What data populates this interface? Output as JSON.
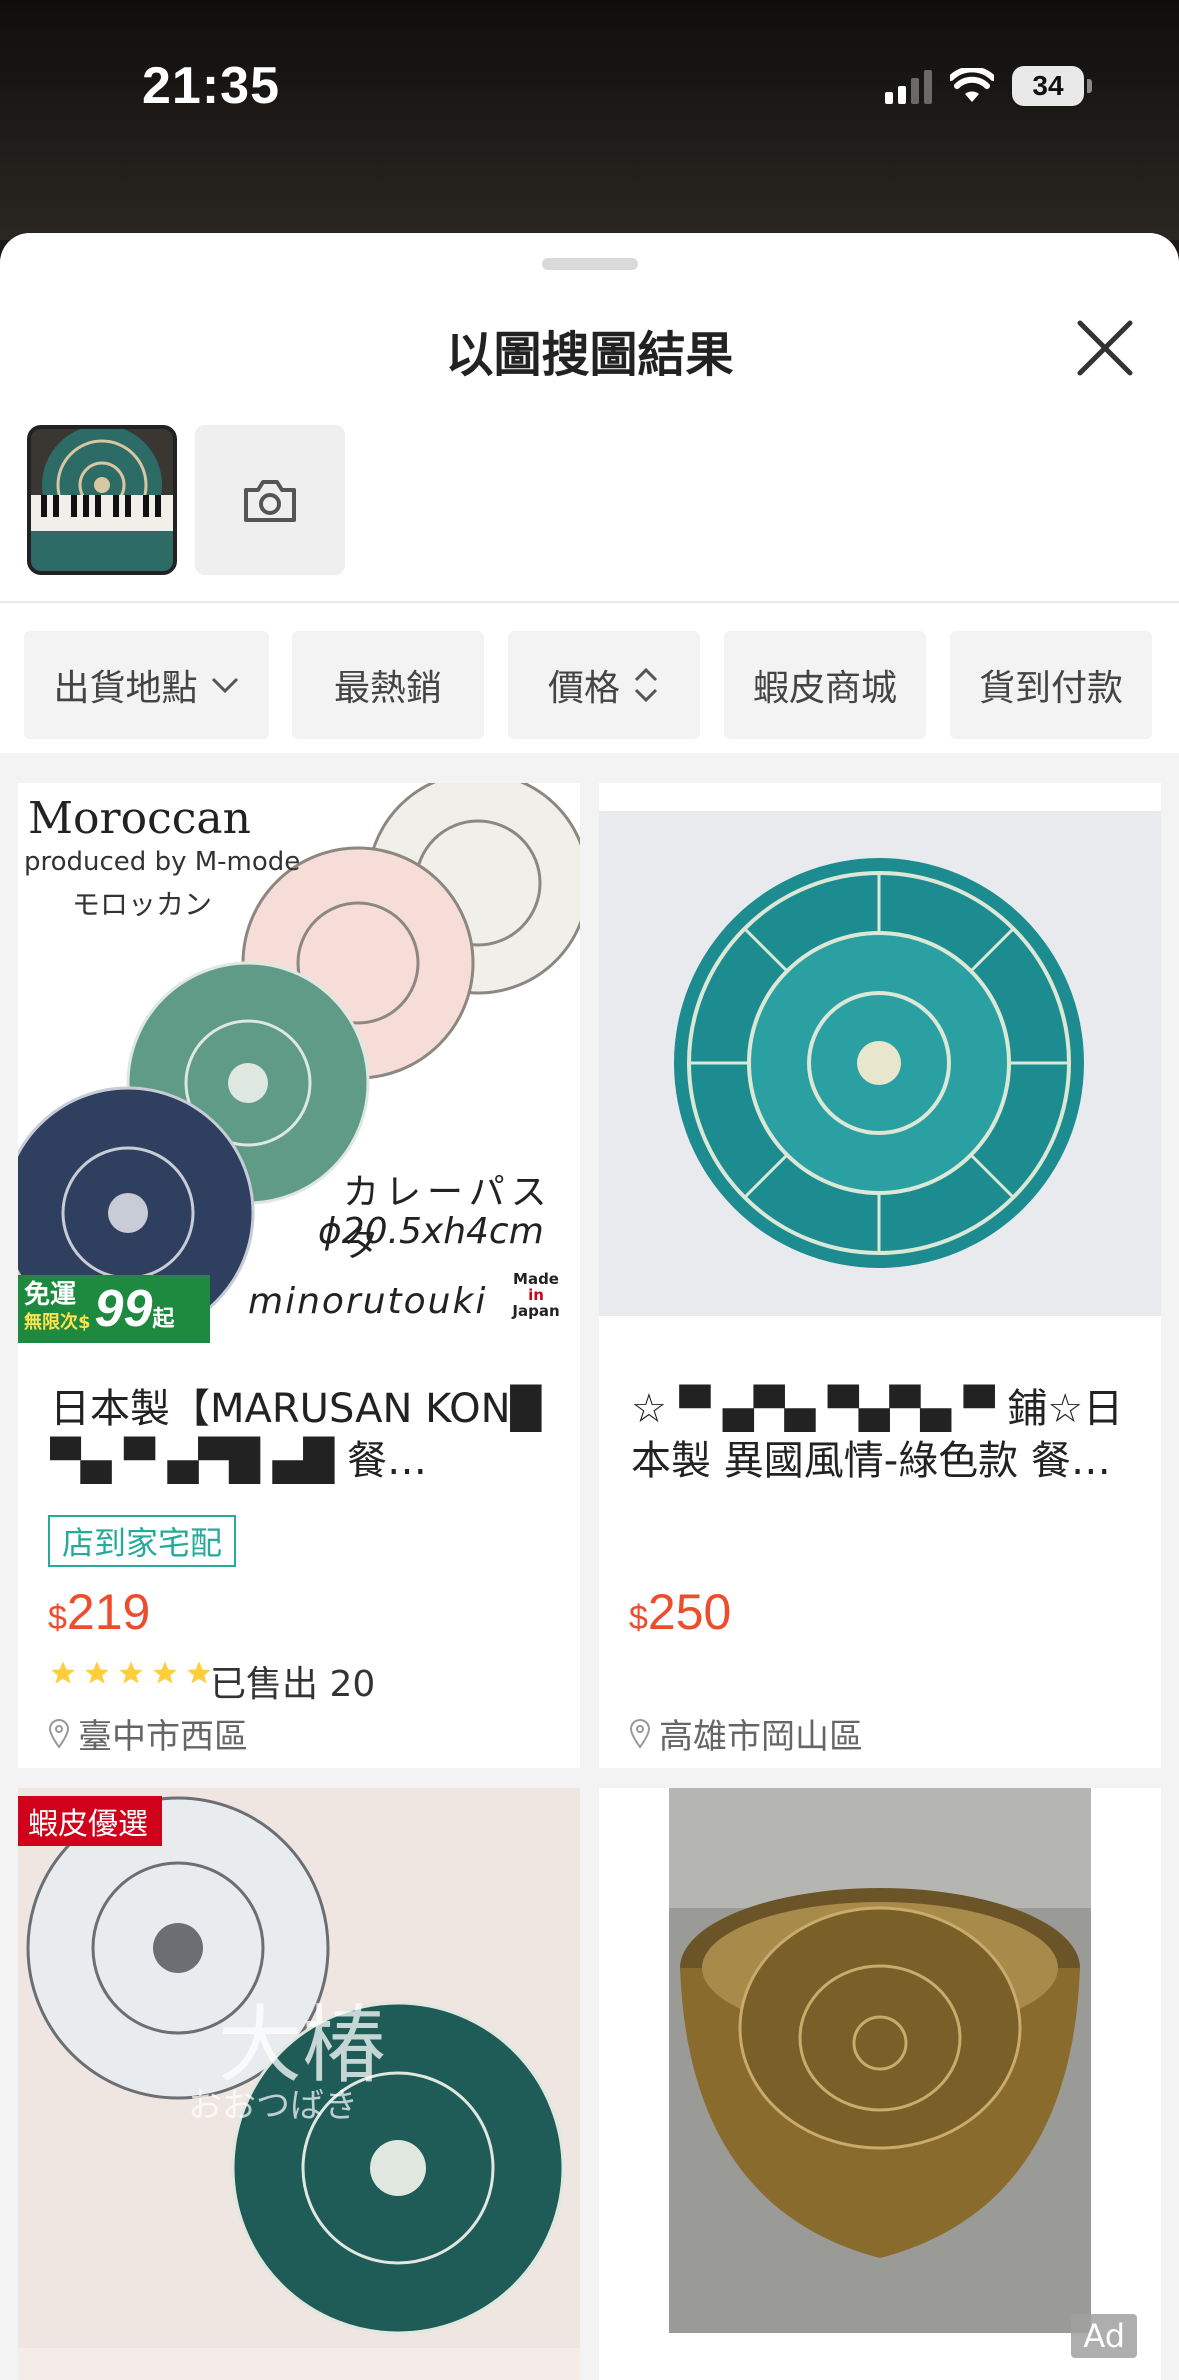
{
  "status_bar": {
    "time": "21:35",
    "battery": "34"
  },
  "sheet": {
    "title": "以圖搜圖結果",
    "close_icon": "close-icon",
    "camera_icon": "camera-icon"
  },
  "filters": [
    {
      "label": "出貨地點",
      "icon": "chevron-down-icon"
    },
    {
      "label": "最熱銷"
    },
    {
      "label": "價格",
      "icon": "sort-arrows-icon"
    },
    {
      "label": "蝦皮商城"
    },
    {
      "label": "貨到付款"
    }
  ],
  "products": [
    {
      "image_text": {
        "brand": "Moroccan",
        "sub": "produced by M-mode",
        "jp": "モロッカン",
        "model": "カレーパスタ",
        "size": "ϕ20.5xh4cm",
        "maker": "minorutouki",
        "made": [
          "Made",
          "in",
          "Japan"
        ],
        "promo_top": "免運",
        "promo_sub": "無限次$",
        "promo_num": "99",
        "promo_unit": "起"
      },
      "title": "日本製【MARUSAN KON█ ▀▄ ▀ ▄▀█ ▄█ 餐…",
      "delivery_tag": "店到家宅配",
      "currency": "$",
      "price": "219",
      "rating": 5,
      "sold": "已售出 20",
      "location": "臺中市西區"
    },
    {
      "title": "☆ ▀ ▄▀▄ ▀▄▀▄ ▀ 鋪☆日本製 異國風情-綠色款 餐…",
      "currency": "$",
      "price": "250",
      "location": "高雄市岡山區"
    },
    {
      "badge": "蝦皮優選",
      "watermark": "大椿",
      "watermark_sub": "おおつばき"
    },
    {
      "ad": "Ad"
    }
  ],
  "colors": {
    "accent": "#ee4d2d",
    "teal": "#26aa99",
    "star": "#ffce3d"
  }
}
